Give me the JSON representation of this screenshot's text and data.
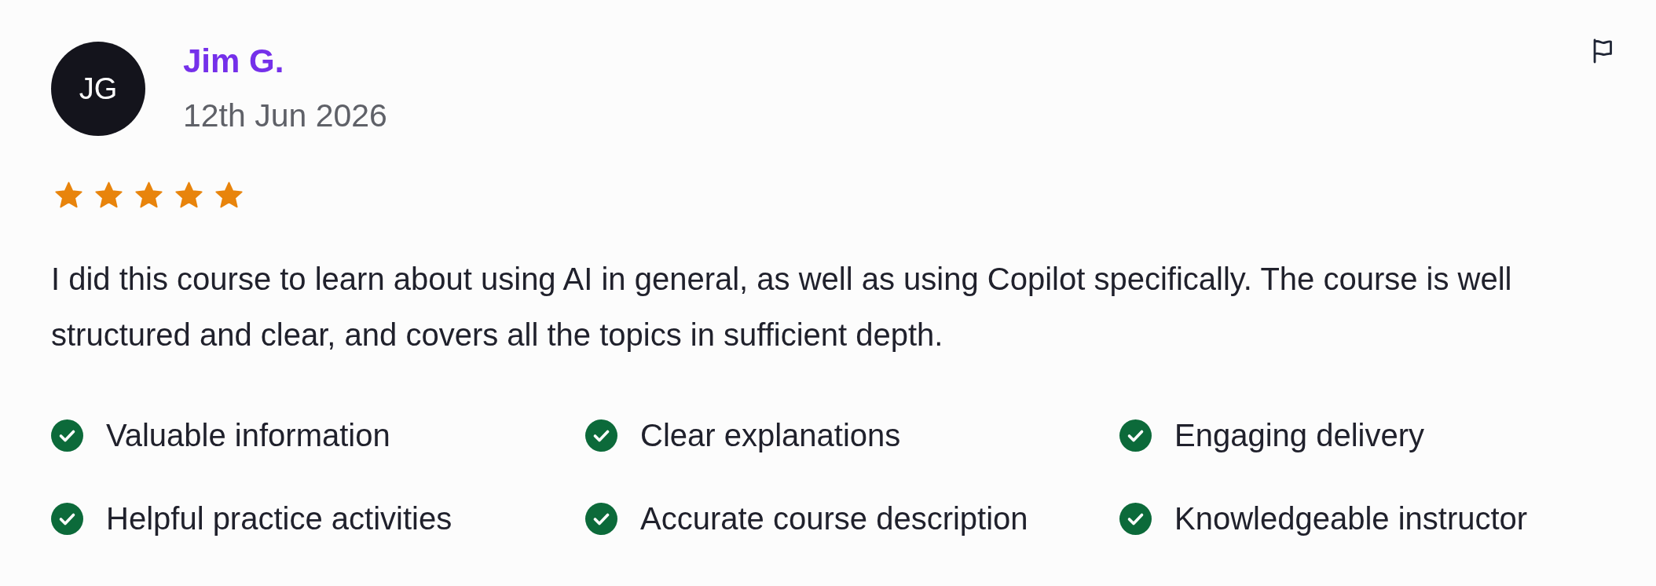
{
  "review": {
    "avatar": {
      "initials": "JG"
    },
    "author": "Jim G.",
    "date": "12th Jun 2026",
    "stars": 5,
    "text": "I did this course to learn about using AI in general, as well as using Copilot specifically. The course is well structured and clear, and covers all the topics in sufficient depth.",
    "highlights": [
      "Valuable information",
      "Clear explanations",
      "Engaging delivery",
      "Helpful practice activities",
      "Accurate course description",
      "Knowledgeable instructor"
    ]
  }
}
